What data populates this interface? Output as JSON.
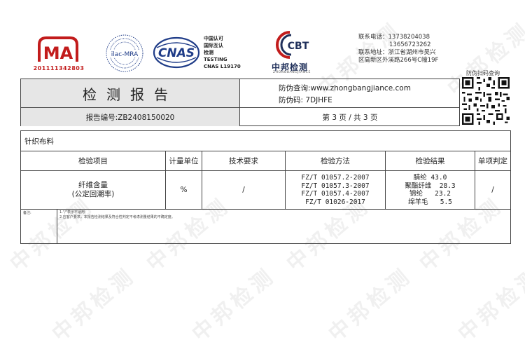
{
  "logos": {
    "cma": {
      "letters": "MA",
      "number": "201111342803"
    },
    "ilac": {
      "text": "ilac-MRA"
    },
    "cnas": {
      "text": "CNAS",
      "lines": [
        "中国认可",
        "国际互认",
        "检测",
        "TESTING",
        "CNAS L19170"
      ]
    },
    "cbt": {
      "mark": "CBT",
      "name": "中邦检测",
      "sub": "ZHONGBANGJIANCE"
    }
  },
  "contact": {
    "phone_label": "联系电话：",
    "phone1": "13738204038",
    "phone2": "13656723262",
    "addr_label": "联系地址：",
    "addr1": "浙江省湖州市吴兴",
    "addr2": "区高新区外溪路266号C幢19F"
  },
  "qr_label": "防伪扫码查询",
  "header": {
    "title": "检测报告",
    "verify_query": "防伪查询:www.zhongbangjiance.com",
    "verify_code": "防伪码: 7DJHFE",
    "report_no": "报告编号:ZB2408150020",
    "page": "第 3 页 / 共 3 页"
  },
  "table": {
    "sample_name": "针织布料",
    "columns": [
      "检验项目",
      "计量单位",
      "技术要求",
      "检验方法",
      "检验结果",
      "单项判定"
    ],
    "row": {
      "item_line1": "纤维含量",
      "item_line2": "(公定回潮率)",
      "unit": "%",
      "requirement": "/",
      "methods": [
        "FZ/T 01057.2-2007",
        "FZ/T 01057.3-2007",
        "FZ/T 01057.4-2007",
        "FZ/T 01026-2017"
      ],
      "results": [
        "腈纶 43.0",
        "聚酯纤维  28.3",
        "锦纶   23.2",
        "绵羊毛   5.5"
      ],
      "judgment": "/"
    },
    "remarks_label": "备注:",
    "remarks": [
      "1.\"/\"表示不适用;",
      "2.应客户要求，本报告检测结果及符合性判定不考虑测量结果的不确定度。"
    ]
  },
  "watermark": "中邦检测",
  "colors": {
    "cma_red": "#c21c1c",
    "cnas_blue": "#1f3c88",
    "cbt_blue": "#1f2f5a",
    "header_gray": "#e6e6e6",
    "border": "#444444"
  }
}
